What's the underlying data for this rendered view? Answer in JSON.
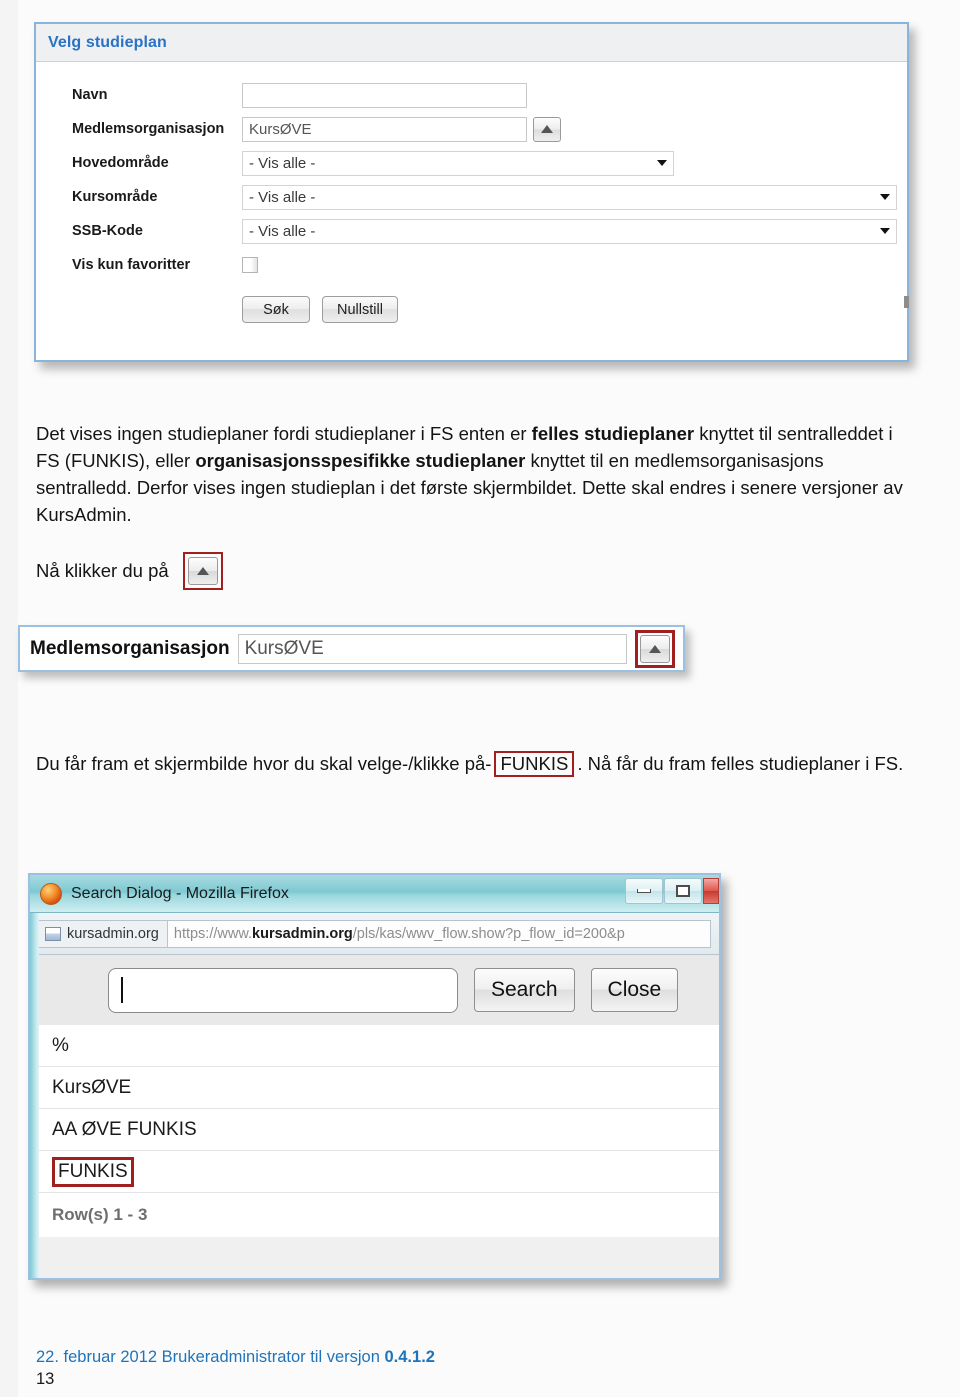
{
  "search_panel": {
    "title": "Velg studieplan",
    "fields": [
      {
        "label": "Navn",
        "value": "",
        "type": "text"
      },
      {
        "label": "Medlemsorganisasjon",
        "value": "KursØVE",
        "type": "text-with-picker"
      },
      {
        "label": "Hovedområde",
        "value": "- Vis alle -",
        "type": "select"
      },
      {
        "label": "Kursområde",
        "value": "- Vis alle -",
        "type": "select"
      },
      {
        "label": "SSB-Kode",
        "value": "- Vis alle -",
        "type": "select"
      },
      {
        "label": "Vis kun favoritter",
        "value": "",
        "type": "checkbox"
      }
    ],
    "buttons": {
      "search": "Søk",
      "reset": "Nullstill"
    }
  },
  "paragraph1": {
    "part1": "Det vises ingen studieplaner fordi studieplaner i FS enten er ",
    "bold1": "felles studieplaner",
    "part2": " knyttet til sentralleddet i FS (FUNKIS),  eller ",
    "bold2": "organisasjonsspesifikke studieplaner",
    "part3": " knyttet til en medlemsorganisasjons sentralledd. Derfor vises ingen studieplan i det første skjermbildet. Dette skal endres i senere versjoner av KursAdmin."
  },
  "click_line": {
    "text": "Nå klikker du på"
  },
  "member_strip": {
    "label": "Medlemsorganisasjon",
    "value": "KursØVE"
  },
  "paragraph2": {
    "part1": "Du får fram et skjermbilde hvor du skal velge-/klikke på-",
    "highlight": "FUNKIS",
    "part2": ". Nå får du fram felles studieplaner i FS."
  },
  "firefox_dialog": {
    "window_title": "Search Dialog - Mozilla Firefox",
    "identity_label": "kursadmin.org",
    "url_prefix": "https://www.",
    "url_domain": "kursadmin.org",
    "url_suffix": "/pls/kas/wwv_flow.show?p_flow_id=200&p",
    "search_value": "",
    "buttons": {
      "search": "Search",
      "close": "Close"
    },
    "results": [
      {
        "value": "%",
        "highlighted": false
      },
      {
        "value": "KursØVE",
        "highlighted": false
      },
      {
        "value": "AA ØVE FUNKIS",
        "highlighted": false
      },
      {
        "value": "FUNKIS",
        "highlighted": true
      }
    ],
    "rows_label": "Row(s) 1 - 3"
  },
  "footer": {
    "date": "22. februar 2012 Brukeradministrator til versjon ",
    "version": "0.4.1.2",
    "page_number": "13"
  },
  "colors": {
    "panel_border": "#8cb3d9",
    "title_blue": "#2b72c4",
    "highlight_red": "#a02020",
    "footer_blue": "#1e74bb"
  }
}
